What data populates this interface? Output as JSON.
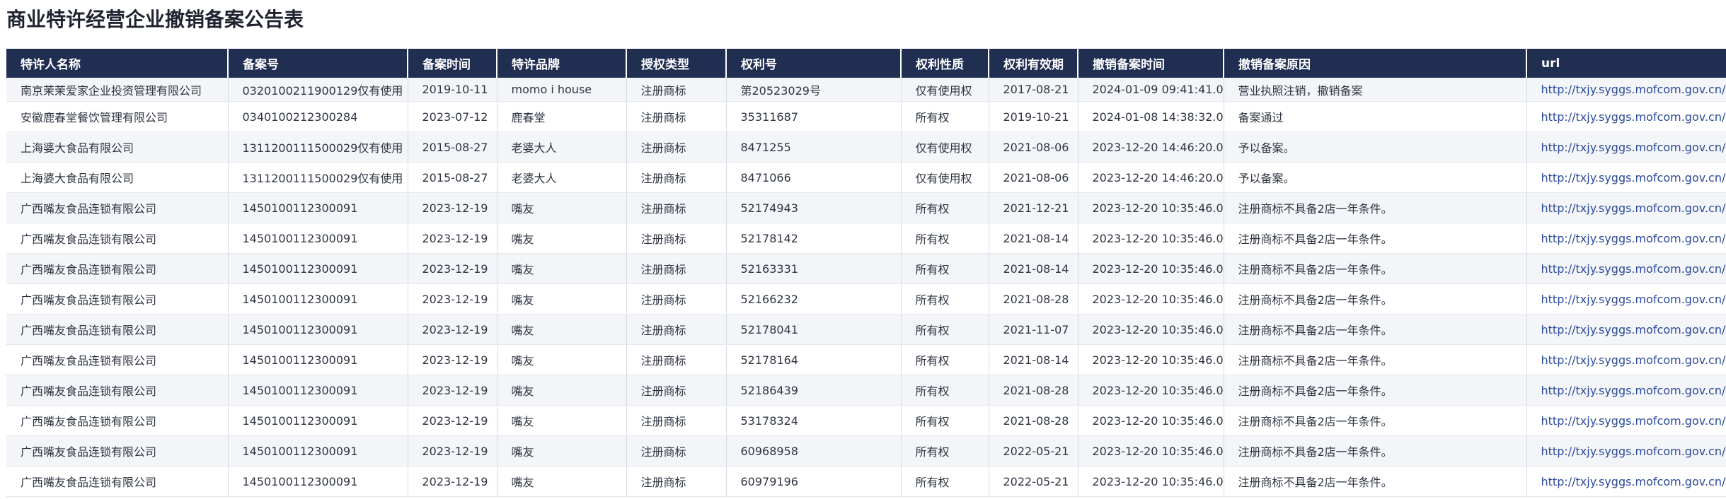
{
  "page": {
    "title": "商业特许经营企业撤销备案公告表"
  },
  "table": {
    "columns": [
      "特许人名称",
      "备案号",
      "备案时间",
      "特许品牌",
      "授权类型",
      "权利号",
      "权利性质",
      "权利有效期",
      "撤销备案时间",
      "撤销备案原因",
      "url"
    ],
    "rows": [
      [
        "南京茉茉爱家企业投资管理有限公司",
        "0320100211900129仅有使用",
        "2019-10-11",
        "momo i house",
        "注册商标",
        "第20523029号",
        "仅有使用权",
        "2017-08-21",
        "2024-01-09 09:41:41.0",
        "营业执照注销，撤销备案",
        "http://txjy.syggs.mofcom.gov.cn/ma"
      ],
      [
        "安徽鹿春堂餐饮管理有限公司",
        "0340100212300284",
        "2023-07-12",
        "鹿春堂",
        "注册商标",
        "35311687",
        "所有权",
        "2019-10-21",
        "2024-01-08 14:38:32.0",
        "备案通过",
        "http://txjy.syggs.mofcom.gov.cn/ma"
      ],
      [
        "上海婆大食品有限公司",
        "1311200111500029仅有使用",
        "2015-08-27",
        "老婆大人",
        "注册商标",
        "8471255",
        "仅有使用权",
        "2021-08-06",
        "2023-12-20 14:46:20.0",
        "予以备案。",
        "http://txjy.syggs.mofcom.gov.cn/ma"
      ],
      [
        "上海婆大食品有限公司",
        "1311200111500029仅有使用",
        "2015-08-27",
        "老婆大人",
        "注册商标",
        "8471066",
        "仅有使用权",
        "2021-08-06",
        "2023-12-20 14:46:20.0",
        "予以备案。",
        "http://txjy.syggs.mofcom.gov.cn/ma"
      ],
      [
        "广西嘴友食品连锁有限公司",
        "1450100112300091",
        "2023-12-19",
        "嘴友",
        "注册商标",
        "52174943",
        "所有权",
        "2021-12-21",
        "2023-12-20 10:35:46.0",
        "注册商标不具备2店一年条件。",
        "http://txjy.syggs.mofcom.gov.cn/ma"
      ],
      [
        "广西嘴友食品连锁有限公司",
        "1450100112300091",
        "2023-12-19",
        "嘴友",
        "注册商标",
        "52178142",
        "所有权",
        "2021-08-14",
        "2023-12-20 10:35:46.0",
        "注册商标不具备2店一年条件。",
        "http://txjy.syggs.mofcom.gov.cn/ma"
      ],
      [
        "广西嘴友食品连锁有限公司",
        "1450100112300091",
        "2023-12-19",
        "嘴友",
        "注册商标",
        "52163331",
        "所有权",
        "2021-08-14",
        "2023-12-20 10:35:46.0",
        "注册商标不具备2店一年条件。",
        "http://txjy.syggs.mofcom.gov.cn/ma"
      ],
      [
        "广西嘴友食品连锁有限公司",
        "1450100112300091",
        "2023-12-19",
        "嘴友",
        "注册商标",
        "52166232",
        "所有权",
        "2021-08-28",
        "2023-12-20 10:35:46.0",
        "注册商标不具备2店一年条件。",
        "http://txjy.syggs.mofcom.gov.cn/ma"
      ],
      [
        "广西嘴友食品连锁有限公司",
        "1450100112300091",
        "2023-12-19",
        "嘴友",
        "注册商标",
        "52178041",
        "所有权",
        "2021-11-07",
        "2023-12-20 10:35:46.0",
        "注册商标不具备2店一年条件。",
        "http://txjy.syggs.mofcom.gov.cn/ma"
      ],
      [
        "广西嘴友食品连锁有限公司",
        "1450100112300091",
        "2023-12-19",
        "嘴友",
        "注册商标",
        "52178164",
        "所有权",
        "2021-08-14",
        "2023-12-20 10:35:46.0",
        "注册商标不具备2店一年条件。",
        "http://txjy.syggs.mofcom.gov.cn/ma"
      ],
      [
        "广西嘴友食品连锁有限公司",
        "1450100112300091",
        "2023-12-19",
        "嘴友",
        "注册商标",
        "52186439",
        "所有权",
        "2021-08-28",
        "2023-12-20 10:35:46.0",
        "注册商标不具备2店一年条件。",
        "http://txjy.syggs.mofcom.gov.cn/ma"
      ],
      [
        "广西嘴友食品连锁有限公司",
        "1450100112300091",
        "2023-12-19",
        "嘴友",
        "注册商标",
        "53178324",
        "所有权",
        "2021-08-28",
        "2023-12-20 10:35:46.0",
        "注册商标不具备2店一年条件。",
        "http://txjy.syggs.mofcom.gov.cn/ma"
      ],
      [
        "广西嘴友食品连锁有限公司",
        "1450100112300091",
        "2023-12-19",
        "嘴友",
        "注册商标",
        "60968958",
        "所有权",
        "2022-05-21",
        "2023-12-20 10:35:46.0",
        "注册商标不具备2店一年条件。",
        "http://txjy.syggs.mofcom.gov.cn/ma"
      ],
      [
        "广西嘴友食品连锁有限公司",
        "1450100112300091",
        "2023-12-19",
        "嘴友",
        "注册商标",
        "60979196",
        "所有权",
        "2022-05-21",
        "2023-12-20 10:35:46.0",
        "注册商标不具备2店一年条件。",
        "http://txjy.syggs.mofcom.gov.cn/ma"
      ]
    ]
  }
}
